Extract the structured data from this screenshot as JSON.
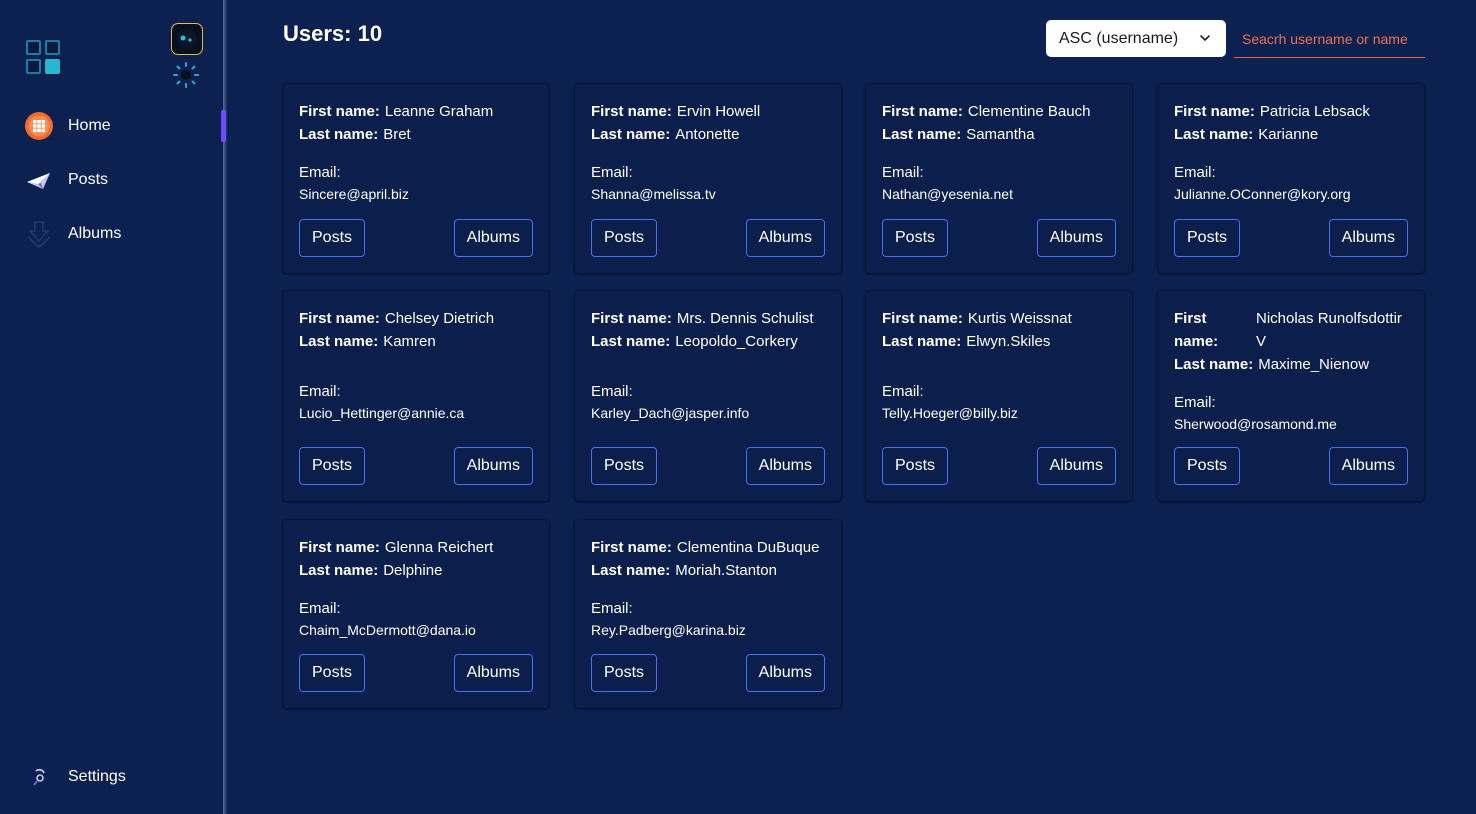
{
  "sidebar": {
    "nav": [
      {
        "label": "Home",
        "icon": "grid-home-icon"
      },
      {
        "label": "Posts",
        "icon": "paper-plane-icon"
      },
      {
        "label": "Albums",
        "icon": "download-box-icon"
      }
    ],
    "settings_label": "Settings"
  },
  "header": {
    "users_count": "Users: 10",
    "sort_value": "ASC (username)",
    "search_placeholder": "Seacrh username or name"
  },
  "labels": {
    "first_name": "First name:",
    "last_name": "Last name:",
    "email": "Email:",
    "posts": "Posts",
    "albums": "Albums"
  },
  "users": [
    {
      "first": "Leanne Graham",
      "last": "Bret",
      "email": "Sincere@april.biz"
    },
    {
      "first": "Ervin Howell",
      "last": "Antonette",
      "email": "Shanna@melissa.tv"
    },
    {
      "first": "Clementine Bauch",
      "last": "Samantha",
      "email": "Nathan@yesenia.net"
    },
    {
      "first": "Patricia Lebsack",
      "last": "Karianne",
      "email": "Julianne.OConner@kory.org"
    },
    {
      "first": "Chelsey Dietrich",
      "last": "Kamren",
      "email": "Lucio_Hettinger@annie.ca"
    },
    {
      "first": "Mrs. Dennis Schulist",
      "last": "Leopoldo_Corkery",
      "email": "Karley_Dach@jasper.info"
    },
    {
      "first": "Kurtis Weissnat",
      "last": "Elwyn.Skiles",
      "email": "Telly.Hoeger@billy.biz"
    },
    {
      "first": "Nicholas Runolfsdottir V",
      "last": "Maxime_Nienow",
      "email": "Sherwood@rosamond.me"
    },
    {
      "first": "Glenna Reichert",
      "last": "Delphine",
      "email": "Chaim_McDermott@dana.io"
    },
    {
      "first": "Clementina DuBuque",
      "last": "Moriah.Stanton",
      "email": "Rey.Padberg@karina.biz"
    }
  ],
  "colors": {
    "background": "#0d2150",
    "accent_border": "#4a6ff0",
    "search_accent": "#e8634a",
    "active_indicator": "#6a4dff"
  }
}
